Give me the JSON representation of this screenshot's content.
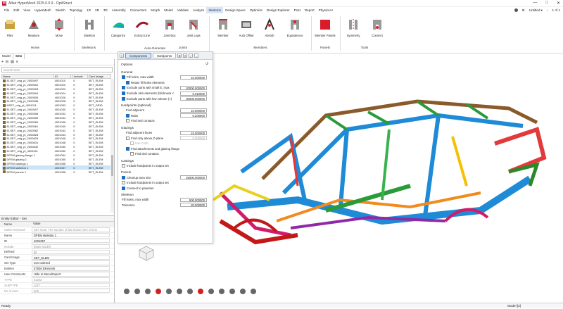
{
  "window": {
    "title": "Altair HyperMesh 2025.0.0.9 - OptiStruct",
    "minimize": "—",
    "maximize": "□",
    "close": "✕"
  },
  "menubar": {
    "items": [
      "File",
      "Edit",
      "View",
      "HyperMesh",
      "Sketch",
      "Topology",
      "1D",
      "2D",
      "3D",
      "Assembly",
      "Connectors",
      "Morph",
      "Model",
      "Validate",
      "Analyze",
      "Skeleton",
      "Design Space",
      "Optimize",
      "Design Explorer",
      "Post",
      "Report",
      "PhysicsAI"
    ],
    "active": "Skeleton",
    "right": {
      "untitled": "Untitled ▾",
      "page": "1 of 1"
    }
  },
  "ribbon": {
    "tools": [
      "Files",
      "Measure",
      "Move",
      "Skeleton",
      "Categorize",
      "Extract Line",
      "Joint Box",
      "Joint Legs",
      "Member",
      "Auto Offset",
      "Absorb",
      "Equivalence",
      "Member Panels",
      "Symmetry",
      "Connect"
    ],
    "groups": [
      "Home",
      "Skeletons",
      "Joints",
      "Members",
      "Panels",
      "Tools"
    ],
    "auto_generate": "Auto-Generate"
  },
  "browser_tabs": [
    "Model",
    "Sets"
  ],
  "sets_browser": {
    "search_placeholder": "Search Sets",
    "columns": [
      "Name",
      "ID",
      "",
      "Include",
      "Card Image"
    ],
    "rows": [
      [
        "ELSET_orig_pl_2000497",
        "4001010",
        "0",
        "SET_ELEM"
      ],
      [
        "ELSET_orig_pl_2000502",
        "4001020",
        "0",
        "SET_ELEM"
      ],
      [
        "ELSET_orig_pl_2000503",
        "4001022",
        "0",
        "SET_ELEM"
      ],
      [
        "ELSET_orig_pl_2000504",
        "4001024",
        "0",
        "SET_ELEM"
      ],
      [
        "ELSET_orig_pl_2000505",
        "4001026",
        "0",
        "SET_ELEM"
      ],
      [
        "ELSET_orig_pl_2000506",
        "4001028",
        "0",
        "SET_ELEM"
      ],
      [
        "NSET_orig_pl_4001011",
        "4001053",
        "0",
        "SET_GRID"
      ],
      [
        "ELSET_orig_pl_2000507",
        "4001030",
        "0",
        "SET_ELEM"
      ],
      [
        "ELSET_orig_pl_2000508",
        "4001032",
        "0",
        "SET_ELEM"
      ],
      [
        "ELSET_orig_pl_2000559",
        "4001034",
        "0",
        "SET_ELEM"
      ],
      [
        "ELSET_orig_pl_2000560",
        "4001036",
        "0",
        "SET_ELEM"
      ],
      [
        "ELSET_orig_pl_2000561",
        "4001040",
        "0",
        "SET_ELEM"
      ],
      [
        "ELSET_orig_pl_2000562",
        "4001042",
        "0",
        "SET_ELEM"
      ],
      [
        "ELSET_orig_pl_2000828",
        "4001044",
        "0",
        "SET_ELEM"
      ],
      [
        "ELSET_orig_pl_2000829",
        "4001046",
        "0",
        "SET_ELEM"
      ],
      [
        "ELSET_orig_pl_2000831",
        "4001048",
        "0",
        "SET_ELEM"
      ],
      [
        "ELSET_orig_pl_2000832",
        "4001050",
        "0",
        "SET_ELEM"
      ],
      [
        "ELSET_orig_pl_4001011",
        "4001052",
        "0",
        "SET_ELEM"
      ],
      [
        "DFEM glazing flange 1",
        "4001054",
        "0",
        "SET_ELEM"
      ],
      [
        "DFEM glazing 1",
        "4001055",
        "0",
        "SET_ELEM"
      ],
      [
        "DFEM castings 1",
        "4001056",
        "0",
        "SET_ELEM"
      ],
      [
        "DFEM skeleton 1",
        "4001057",
        "0",
        "SET_ELEM"
      ],
      [
        "DFEM panels 1",
        "4001058",
        "0",
        "SET_ELEM"
      ]
    ],
    "selected_index": 21
  },
  "entity_editor": {
    "title": "Entity Editor - Set",
    "header": [
      "Name",
      "Value"
    ],
    "rows": [
      {
        "k": "Solver Keyword",
        "v": "SET   Note: The number of ids shown here is limit",
        "gray": true
      },
      {
        "k": "Name",
        "v": "DFEM skeleton 1"
      },
      {
        "k": "ID",
        "v": "4001057"
      },
      {
        "k": "Include",
        "v": "[Main Model]",
        "gray": true
      },
      {
        "k": "Defined",
        "v": "☑"
      },
      {
        "k": "Card Image",
        "v": "SET_ELEM"
      },
      {
        "k": "Set Type",
        "v": "non-ordered"
      },
      {
        "k": "Entities",
        "v": "57836 Elements"
      },
      {
        "k": "User Comments",
        "v": "Hide In Menu/Export"
      },
      {
        "k": "TYPE",
        "v": "ELEM",
        "gray": true
      },
      {
        "k": "SUBTYPE",
        "v": "LIST",
        "gray": true
      },
      {
        "k": "No of rows",
        "v": "506",
        "gray": true
      }
    ]
  },
  "options_panel": {
    "tabs": [
      "Components",
      "Hardpoints"
    ],
    "heading": "Options",
    "general_label": "General",
    "general": [
      {
        "label": "Fill holes, max width",
        "checked": true,
        "value": "10.000000",
        "indent": 0
      },
      {
        "label": "Retain fill holes elements",
        "checked": true,
        "indent": 1
      },
      {
        "label": "Exclude parts with small E, max",
        "checked": true,
        "value": "20000.000000",
        "indent": 0
      },
      {
        "label": "Exclude skin elements (thickness <",
        "checked": true,
        "value": "0.010000",
        "indent": 0
      },
      {
        "label": "Exclude parts with low volume (<)",
        "checked": true,
        "value": "30000.000000",
        "indent": 0
      }
    ],
    "hardpoints_label": "Hardpoints (optional)",
    "hardpoints": [
      {
        "label": "Find adjacent",
        "checked": null,
        "value": "10.000000",
        "indent": 1
      },
      {
        "label": "Ratio",
        "checked": true,
        "value": "0.200000",
        "indent": 1
      },
      {
        "label": "Find tied contacts",
        "checked": false,
        "indent": 1
      }
    ],
    "glazings_label": "Glazings",
    "glazings": [
      {
        "label": "Find adjacent faces",
        "checked": null,
        "value": "15.000000",
        "indent": 1
      },
      {
        "label": "Find only above Z-plane",
        "checked": false,
        "value": "0.000000",
        "disabled_value": true,
        "indent": 1
      },
      {
        "label": "Use CofG",
        "checked": false,
        "disabled": true,
        "indent": 2
      },
      {
        "label": "Find attachments and glazing flange",
        "checked": true,
        "indent": 1
      },
      {
        "label": "Find tied contacts",
        "checked": false,
        "indent": 2
      }
    ],
    "castings_label": "Castings",
    "castings": [
      {
        "label": "Include hardpoints in output set",
        "checked": false,
        "indent": 0
      }
    ],
    "panels_label": "Panels",
    "panels": [
      {
        "label": "Cleanup area size",
        "checked": true,
        "value": "25000.000000",
        "indent": 0
      },
      {
        "label": "Include hardpoints in output set",
        "checked": false,
        "indent": 0
      },
      {
        "label": "Connect to panelset",
        "checked": true,
        "indent": 0
      }
    ],
    "skeleton_label": "Skeleton",
    "skeleton": [
      {
        "label": "Fill holes, max width",
        "checked": null,
        "value": "500.000000",
        "indent": 0
      },
      {
        "label": "Tolerance",
        "checked": null,
        "value": "20.000000",
        "indent": 0
      }
    ]
  },
  "statusbar": {
    "left": "Ready",
    "model": "Model [2]"
  }
}
